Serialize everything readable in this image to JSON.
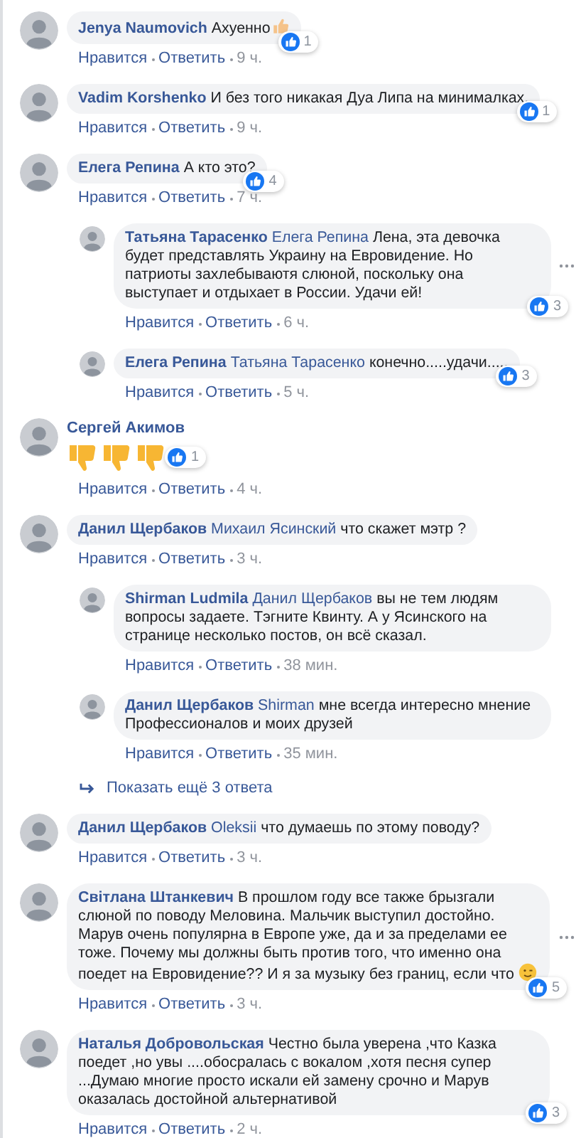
{
  "comments": [
    {
      "kind": "text",
      "author": "Jenya Naumovich",
      "text": "Ахуенно",
      "emoji": {
        "kind": "thumbs_up"
      },
      "reactions": "1",
      "like": "Нравится",
      "reply": "Ответить",
      "time": "9 ч."
    },
    {
      "kind": "text",
      "author": "Vadim Korshenko",
      "text": "И без того никакая Дуа Липа на минималках.",
      "reactions": "1",
      "like": "Нравится",
      "reply": "Ответить",
      "time": "9 ч."
    },
    {
      "kind": "text",
      "author": "Елега Репина",
      "text": "А кто это?",
      "reactions": "4",
      "like": "Нравится",
      "reply": "Ответить",
      "time": "7 ч.",
      "children": [
        {
          "kind": "text",
          "author": "Татьяна Тарасенко",
          "mention": "Елега Репина",
          "text": "Лена, эта девочка будет представлять Украину на Евровидение. Но патриоты захлебываютя слюной, поскольку она выступает и отдыхает в России. Удачи ей!",
          "reactions": "3",
          "like": "Нравится",
          "reply": "Ответить",
          "time": "6 ч.",
          "menu": true
        },
        {
          "kind": "text",
          "author": "Елега Репина",
          "mention": "Татьяна Тарасенко",
          "text": "конечно.....удачи.....",
          "reactions": "3",
          "like": "Нравится",
          "reply": "Ответить",
          "time": "5 ч."
        }
      ]
    },
    {
      "kind": "emoji",
      "author": "Сергей Акимов",
      "reactions": "1",
      "like": "Нравится",
      "reply": "Ответить",
      "time": "4 ч."
    },
    {
      "kind": "text",
      "author": "Данил Щербаков",
      "mention": "Михаил Ясинский",
      "text": "что скажет мэтр ?",
      "like": "Нравится",
      "reply": "Ответить",
      "time": "3 ч.",
      "children": [
        {
          "kind": "text",
          "author": "Shirman Ludmila",
          "mention": "Данил Щербаков",
          "text": "вы не тем людям вопросы задаете. Тэгните Квинту. А у Ясинского на странице несколько постов, он всё сказал.",
          "like": "Нравится",
          "reply": "Ответить",
          "time": "38 мин."
        },
        {
          "kind": "text",
          "author": "Данил Щербаков",
          "mention": "Shirman",
          "text": "мне всегда интересно мнение Профессионалов и моих друзей",
          "like": "Нравится",
          "reply": "Ответить",
          "time": "35 мин."
        }
      ],
      "more_replies": "Показать ещё 3 ответа"
    },
    {
      "kind": "text",
      "author": "Данил Щербаков",
      "mention": "Oleksii",
      "text": "что думаешь по этому поводу?",
      "like": "Нравится",
      "reply": "Ответить",
      "time": "3 ч."
    },
    {
      "kind": "text",
      "author": "Світлана Штанкевич",
      "text": "В прошлом году все также брызгали слюной по поводу Меловина. Мальчик выступил достойно. Марув очень популярна в Европе уже, да и за пределами ее тоже. Почему мы должны быть против того, что именно она поедет на Евровидение?? И я за музыку без границ, если что",
      "emoji": {
        "kind": "wink"
      },
      "reactions": "5",
      "like": "Нравится",
      "reply": "Ответить",
      "time": "3 ч.",
      "menu": true
    },
    {
      "kind": "text",
      "author": "Наталья Добровольская",
      "text": "Честно была уверена ,что Казка поедет ,но увы ....обосралась с вокалом ,хотя песня супер ...Думаю многие просто искали ей замену срочно и Марув оказалась достойной альтернативой",
      "reactions": "3",
      "like": "Нравится",
      "reply": "Ответить",
      "time": "2 ч."
    }
  ]
}
